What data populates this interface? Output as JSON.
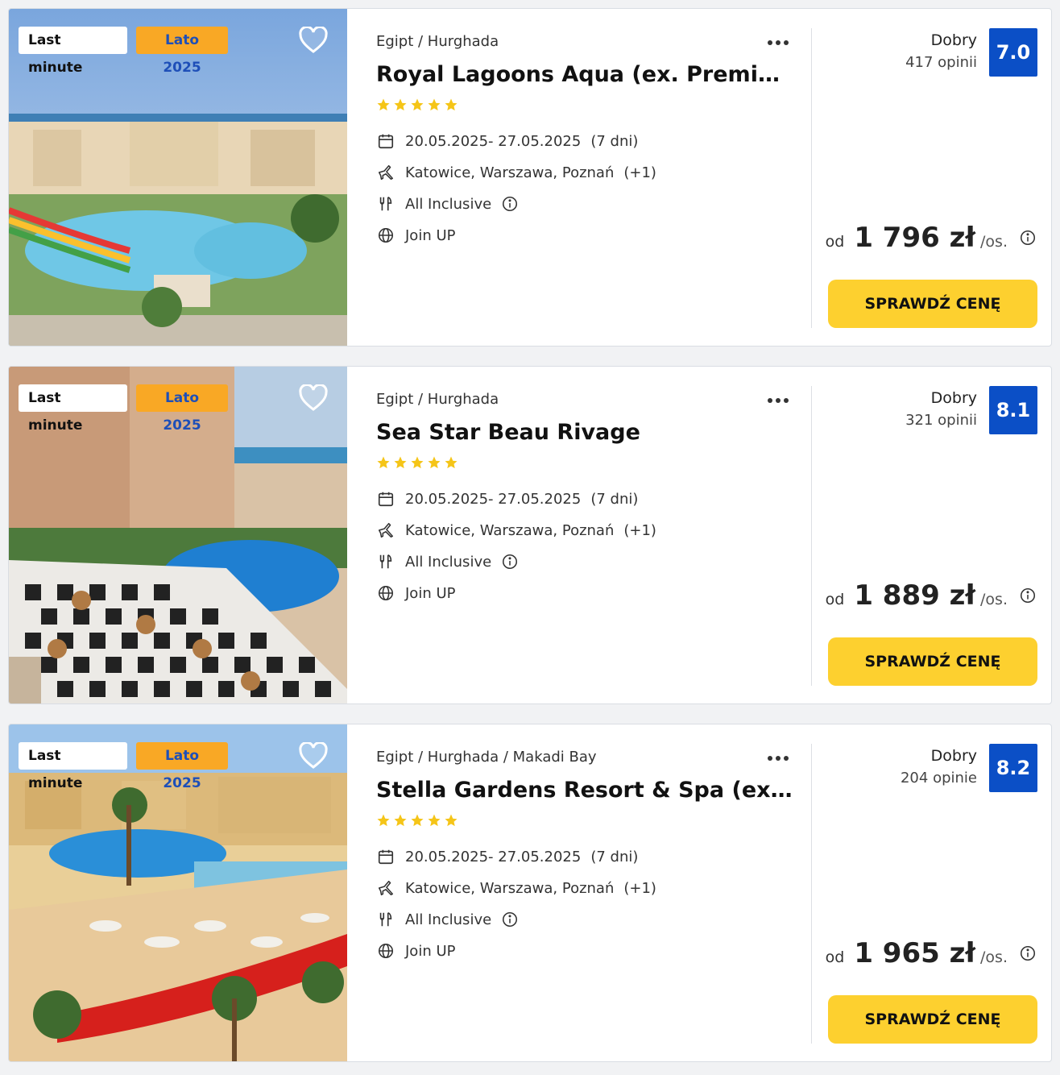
{
  "offers": [
    {
      "badge_lastminute": "Last minute",
      "badge_season": "Lato 2025",
      "breadcrumb": "Egipt / Hurghada",
      "title": "Royal Lagoons Aqua (ex. Premium B…",
      "stars": 5,
      "dates": "20.05.2025- 27.05.2025",
      "duration": "(7 dni)",
      "departures": "Katowice, Warszawa, Poznań",
      "departures_more": "(+1)",
      "board": "All Inclusive",
      "operator": "Join UP",
      "rating_word": "Dobry",
      "rating_count": "417 opinii",
      "rating_score": "7.0",
      "price_prefix": "od",
      "price": "1 796 zł",
      "price_unit": "/os.",
      "cta": "SPRAWDŹ CENĘ"
    },
    {
      "badge_lastminute": "Last minute",
      "badge_season": "Lato 2025",
      "breadcrumb": "Egipt / Hurghada",
      "title": "Sea Star Beau Rivage",
      "stars": 5,
      "dates": "20.05.2025- 27.05.2025",
      "duration": "(7 dni)",
      "departures": "Katowice, Warszawa, Poznań",
      "departures_more": "(+1)",
      "board": "All Inclusive",
      "operator": "Join UP",
      "rating_word": "Dobry",
      "rating_count": "321 opinii",
      "rating_score": "8.1",
      "price_prefix": "od",
      "price": "1 889 zł",
      "price_unit": "/os.",
      "cta": "SPRAWDŹ CENĘ"
    },
    {
      "badge_lastminute": "Last minute",
      "badge_season": "Lato 2025",
      "breadcrumb": "Egipt / Hurghada / Makadi Bay",
      "title": "Stella Gardens Resort & Spa (ex Stell…",
      "stars": 5,
      "dates": "20.05.2025- 27.05.2025",
      "duration": "(7 dni)",
      "departures": "Katowice, Warszawa, Poznań",
      "departures_more": "(+1)",
      "board": "All Inclusive",
      "operator": "Join UP",
      "rating_word": "Dobry",
      "rating_count": "204 opinie",
      "rating_score": "8.2",
      "price_prefix": "od",
      "price": "1 965 zł",
      "price_unit": "/os.",
      "cta": "SPRAWDŹ CENĘ"
    }
  ],
  "icons": {
    "favorite": "heart-outline-icon",
    "more": "more-dots-icon",
    "dates": "calendar-icon",
    "departures": "plane-icon",
    "board": "cutlery-icon",
    "operator": "globe-icon",
    "info": "info-circle-icon",
    "rating": "star-icon"
  },
  "colors": {
    "cta": "#fdd02f",
    "rating_box": "#0b4fc6",
    "season_badge": "#f9a825",
    "season_text": "#1e4fb8",
    "stars": "#f5c518"
  }
}
